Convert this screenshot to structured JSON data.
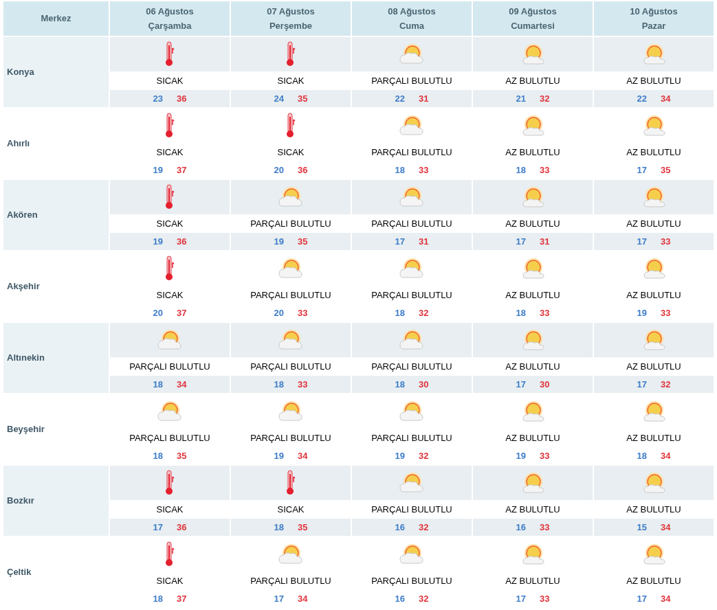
{
  "header": {
    "center_label": "Merkez",
    "days": [
      {
        "date": "06 Ağustos",
        "weekday": "Çarşamba"
      },
      {
        "date": "07 Ağustos",
        "weekday": "Perşembe"
      },
      {
        "date": "08 Ağustos",
        "weekday": "Cuma"
      },
      {
        "date": "09 Ağustos",
        "weekday": "Cumartesi"
      },
      {
        "date": "10 Ağustos",
        "weekday": "Pazar"
      }
    ]
  },
  "rows": [
    {
      "name": "Konya",
      "forecasts": [
        {
          "kind": "hot",
          "condition": "SICAK",
          "low": "23",
          "high": "36"
        },
        {
          "kind": "hot",
          "condition": "SICAK",
          "low": "24",
          "high": "35"
        },
        {
          "kind": "partly",
          "condition": "PARÇALI BULUTLU",
          "low": "22",
          "high": "31"
        },
        {
          "kind": "few",
          "condition": "AZ BULUTLU",
          "low": "21",
          "high": "32"
        },
        {
          "kind": "few",
          "condition": "AZ BULUTLU",
          "low": "22",
          "high": "34"
        }
      ]
    },
    {
      "name": "Ahırlı",
      "forecasts": [
        {
          "kind": "hot",
          "condition": "SICAK",
          "low": "19",
          "high": "37"
        },
        {
          "kind": "hot",
          "condition": "SICAK",
          "low": "20",
          "high": "36"
        },
        {
          "kind": "partly",
          "condition": "PARÇALI BULUTLU",
          "low": "18",
          "high": "33"
        },
        {
          "kind": "few",
          "condition": "AZ BULUTLU",
          "low": "18",
          "high": "33"
        },
        {
          "kind": "few",
          "condition": "AZ BULUTLU",
          "low": "17",
          "high": "35"
        }
      ]
    },
    {
      "name": "Akören",
      "forecasts": [
        {
          "kind": "hot",
          "condition": "SICAK",
          "low": "19",
          "high": "36"
        },
        {
          "kind": "partly",
          "condition": "PARÇALI BULUTLU",
          "low": "19",
          "high": "35"
        },
        {
          "kind": "partly",
          "condition": "PARÇALI BULUTLU",
          "low": "17",
          "high": "31"
        },
        {
          "kind": "few",
          "condition": "AZ BULUTLU",
          "low": "17",
          "high": "31"
        },
        {
          "kind": "few",
          "condition": "AZ BULUTLU",
          "low": "17",
          "high": "33"
        }
      ]
    },
    {
      "name": "Akşehir",
      "forecasts": [
        {
          "kind": "hot",
          "condition": "SICAK",
          "low": "20",
          "high": "37"
        },
        {
          "kind": "partly",
          "condition": "PARÇALI BULUTLU",
          "low": "20",
          "high": "33"
        },
        {
          "kind": "partly",
          "condition": "PARÇALI BULUTLU",
          "low": "18",
          "high": "32"
        },
        {
          "kind": "few",
          "condition": "AZ BULUTLU",
          "low": "18",
          "high": "33"
        },
        {
          "kind": "few",
          "condition": "AZ BULUTLU",
          "low": "19",
          "high": "33"
        }
      ]
    },
    {
      "name": "Altınekin",
      "forecasts": [
        {
          "kind": "partly",
          "condition": "PARÇALI BULUTLU",
          "low": "18",
          "high": "34"
        },
        {
          "kind": "partly",
          "condition": "PARÇALI BULUTLU",
          "low": "18",
          "high": "33"
        },
        {
          "kind": "partly",
          "condition": "PARÇALI BULUTLU",
          "low": "18",
          "high": "30"
        },
        {
          "kind": "few",
          "condition": "AZ BULUTLU",
          "low": "17",
          "high": "30"
        },
        {
          "kind": "few",
          "condition": "AZ BULUTLU",
          "low": "17",
          "high": "32"
        }
      ]
    },
    {
      "name": "Beyşehir",
      "forecasts": [
        {
          "kind": "partly",
          "condition": "PARÇALI BULUTLU",
          "low": "18",
          "high": "35"
        },
        {
          "kind": "partly",
          "condition": "PARÇALI BULUTLU",
          "low": "19",
          "high": "34"
        },
        {
          "kind": "partly",
          "condition": "PARÇALI BULUTLU",
          "low": "19",
          "high": "32"
        },
        {
          "kind": "few",
          "condition": "AZ BULUTLU",
          "low": "19",
          "high": "33"
        },
        {
          "kind": "few",
          "condition": "AZ BULUTLU",
          "low": "18",
          "high": "34"
        }
      ]
    },
    {
      "name": "Bozkır",
      "forecasts": [
        {
          "kind": "hot",
          "condition": "SICAK",
          "low": "17",
          "high": "36"
        },
        {
          "kind": "hot",
          "condition": "SICAK",
          "low": "18",
          "high": "35"
        },
        {
          "kind": "partly",
          "condition": "PARÇALI BULUTLU",
          "low": "16",
          "high": "32"
        },
        {
          "kind": "few",
          "condition": "AZ BULUTLU",
          "low": "16",
          "high": "33"
        },
        {
          "kind": "few",
          "condition": "AZ BULUTLU",
          "low": "15",
          "high": "34"
        }
      ]
    },
    {
      "name": "Çeltik",
      "forecasts": [
        {
          "kind": "hot",
          "condition": "SICAK",
          "low": "18",
          "high": "37"
        },
        {
          "kind": "partly",
          "condition": "PARÇALI BULUTLU",
          "low": "17",
          "high": "34"
        },
        {
          "kind": "partly",
          "condition": "PARÇALI BULUTLU",
          "low": "16",
          "high": "32"
        },
        {
          "kind": "few",
          "condition": "AZ BULUTLU",
          "low": "17",
          "high": "33"
        },
        {
          "kind": "few",
          "condition": "AZ BULUTLU",
          "low": "17",
          "high": "34"
        }
      ]
    }
  ]
}
